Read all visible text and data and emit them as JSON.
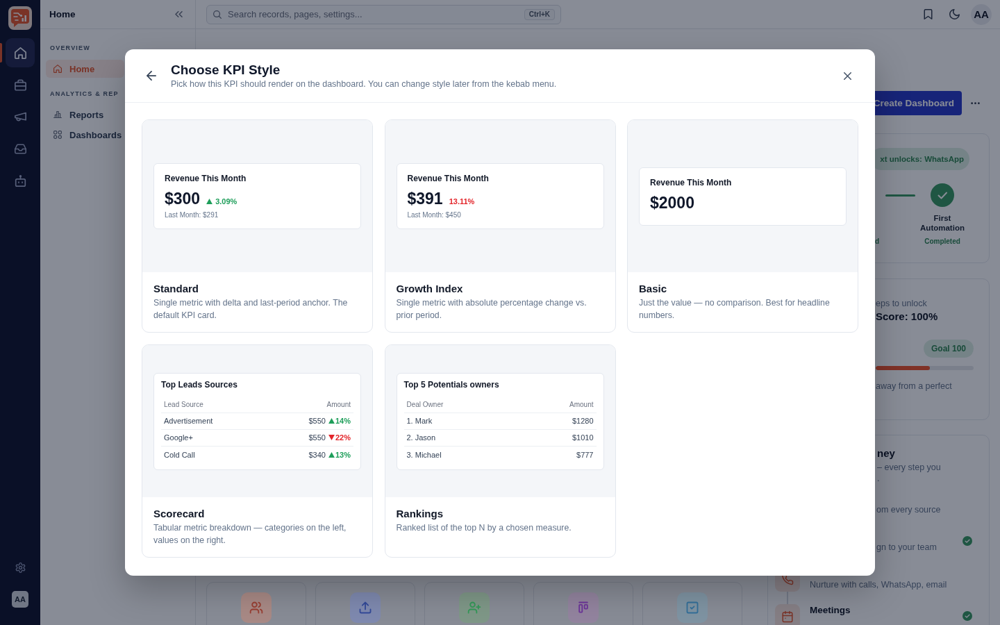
{
  "rail": {
    "items": [
      {
        "selected": true
      },
      {
        "selected": false
      },
      {
        "selected": false
      },
      {
        "selected": false
      },
      {
        "selected": false
      }
    ],
    "avatar": "AA"
  },
  "sidebar": {
    "title": "Home",
    "sections": [
      {
        "label": "OVERVIEW",
        "items": [
          {
            "label": "Home",
            "selected": true
          }
        ]
      },
      {
        "label": "ANALYTICS & REP",
        "items": [
          {
            "label": "Reports",
            "selected": false
          },
          {
            "label": "Dashboards",
            "selected": false
          }
        ]
      }
    ]
  },
  "topbar": {
    "search": {
      "placeholder": "Search records, pages, settings...",
      "shortcut": "Ctrl+K"
    },
    "avatar": "AA"
  },
  "header_actions": {
    "create_button": "Create Dashboard"
  },
  "milestone_card": {
    "badge": "xt unlocks: WhatsApp",
    "steps": [
      {
        "status": "d",
        "done": true
      },
      {
        "label": "First Automation",
        "status": "Completed",
        "done": true
      }
    ]
  },
  "score_card": {
    "subtitle": "eps to unlock",
    "title": "Score: 100%",
    "goal": "Goal 100",
    "level": 0.55,
    "note": "away from a perfect"
  },
  "journey_card": {
    "title": "ney",
    "intro_lines": [
      "– every step you",
      "."
    ],
    "steps": [
      {
        "description": "om every source",
        "done": false
      },
      {
        "description": "gn to your team",
        "done": true
      },
      {
        "description": "Nurture with calls, WhatsApp, email",
        "done": false
      },
      {
        "title": "Meetings",
        "done": true
      }
    ]
  },
  "quick_actions": [
    {
      "color": "#a98a86"
    },
    {
      "color": "#7f8ab0"
    },
    {
      "color": "#7f9888"
    },
    {
      "color": "#93849f"
    },
    {
      "color": "#7f94a3"
    }
  ],
  "modal": {
    "title": "Choose KPI Style",
    "subtitle": "Pick how this KPI should render on the dashboard. You can change style later from the kebab menu.",
    "styles": [
      {
        "kind": "standard",
        "name": "Standard",
        "description": "Single metric with delta and last-period anchor. The default KPI card.",
        "selected": false,
        "preview": {
          "title": "Revenue This Month",
          "value": "$300",
          "change": "3.09%",
          "up": true,
          "footnote": "Last Month: $291"
        }
      },
      {
        "kind": "growth",
        "name": "Growth Index",
        "description": "Single metric with absolute percentage change vs. prior period.",
        "selected": false,
        "preview": {
          "title": "Revenue This Month",
          "value": "$391",
          "change": "13.11%",
          "up": false,
          "footnote": "Last Month: $450"
        }
      },
      {
        "kind": "basic",
        "name": "Basic",
        "description": "Just the value — no comparison. Best for headline numbers.",
        "selected": false,
        "preview": {
          "title": "Revenue This Month",
          "value": "$2000"
        }
      },
      {
        "kind": "scorecard",
        "name": "Scorecard",
        "description": "Tabular metric breakdown — categories on the left, values on the right.",
        "selected": false,
        "preview": {
          "title": "Top Leads Sources",
          "columns": [
            "Lead Source",
            "Amount"
          ],
          "rows": [
            {
              "label": "Advertisement",
              "amount": "$550",
              "change": "14%",
              "up": true
            },
            {
              "label": "Google+",
              "amount": "$550",
              "change": "22%",
              "up": false
            },
            {
              "label": "Cold Call",
              "amount": "$340",
              "change": "13%",
              "up": true
            }
          ]
        }
      },
      {
        "kind": "rankings",
        "name": "Rankings",
        "description": "Ranked list of the top N by a chosen measure.",
        "selected": false,
        "preview": {
          "title": "Top 5 Potentials owners",
          "columns": [
            "Deal Owner",
            "Amount"
          ],
          "rows": [
            {
              "label": "1. Mark",
              "amount": "$1280"
            },
            {
              "label": "2. Jason",
              "amount": "$1010"
            },
            {
              "label": "3. Michael",
              "amount": "$777"
            }
          ]
        }
      }
    ]
  }
}
